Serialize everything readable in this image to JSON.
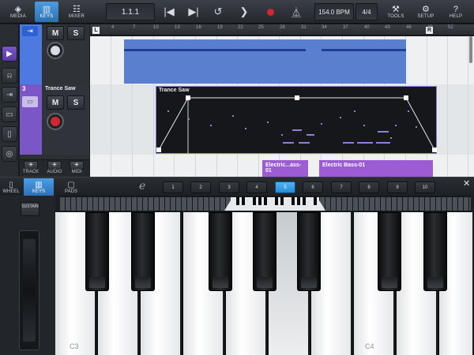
{
  "toolbar": {
    "media": "MEDIA",
    "keys": "KEYS",
    "mixer": "MIXER",
    "position": "1.1.1",
    "tempo": "154.0 BPM",
    "signature": "4/4",
    "tools": "TOOLS",
    "setup": "SETUP",
    "help": "HELP"
  },
  "ruler": {
    "ticks": [
      "4",
      "7",
      "10",
      "13",
      "16",
      "19",
      "22",
      "25",
      "28",
      "31",
      "34",
      "37",
      "40",
      "43",
      "46",
      "49",
      "52"
    ],
    "left_locator": "L",
    "right_locator": "R"
  },
  "tracks": {
    "track2_number": "3",
    "track2_name": "Trance Saw",
    "mute": "M",
    "solo": "S"
  },
  "track_footer": {
    "track": "TRACK",
    "audio": "AUDIO",
    "midi": "MIDI"
  },
  "parts": {
    "synth": "Trance Saw",
    "bass1": "Electric...ass-01",
    "bass2": "Electric Bass-01"
  },
  "keyboard_tools": {
    "wheel": "WHEEL",
    "keys": "KEYS",
    "pads": "PADS",
    "octaves": [
      "1",
      "2",
      "3",
      "4",
      "5",
      "6",
      "7",
      "8",
      "9",
      "10"
    ],
    "selected_octave": "5"
  },
  "keyboard": {
    "sustain": "SUSTAIN",
    "label_c3": "C3",
    "label_c4": "C4"
  },
  "colors": {
    "accent_blue": "#2d8ad6",
    "track_purple": "#7a56c7",
    "part_blue": "#5a7fcf",
    "record_red": "#d22630"
  }
}
